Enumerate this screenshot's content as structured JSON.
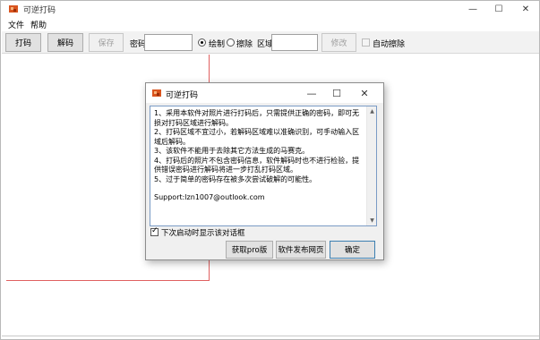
{
  "app": {
    "title": "可逆打码",
    "icon": "app-logo-icon",
    "controls": {
      "minimize": "—",
      "maximize": "☐",
      "close": "✕"
    }
  },
  "menu": {
    "file": "文件",
    "help": "帮助"
  },
  "toolbar": {
    "encode": "打码",
    "decode": "解码",
    "save": "保存",
    "password_label": "密码",
    "password_value": "",
    "draw": "绘制",
    "erase": "擦除",
    "mode_selected": "绘制",
    "region_label": "区域",
    "region_value": "",
    "modify": "修改",
    "auto_erase": "自动擦除",
    "auto_erase_checked": false
  },
  "dialog": {
    "title": "可逆打码",
    "controls": {
      "minimize": "—",
      "maximize": "☐",
      "close": "✕"
    },
    "lines": [
      "1、采用本软件对照片进行打码后，只需提供正确的密码，即可无损对打码区域进行解码。",
      "2、打码区域不宜过小，若解码区域难以准确识别，可手动输入区域后解码。",
      "3、该软件不能用于去除其它方法生成的马赛克。",
      "4、打码后的照片不包含密码信息，软件解码时也不进行检验，提供错误密码进行解码将进一步打乱打码区域。",
      "5、过于简单的密码存在被多次尝试破解的可能性。"
    ],
    "support": "Support:lzn1007@outlook.com",
    "show_on_start": "下次启动时显示该对话框",
    "show_on_start_checked": true,
    "buttons": {
      "get_pro": "获取pro版",
      "publish_page": "软件发布网页",
      "ok": "确定"
    }
  },
  "colors": {
    "accent_border": "#7a9bc5",
    "canvas_guide": "#e06060",
    "toolbar_bg": "#f2f2f2"
  }
}
